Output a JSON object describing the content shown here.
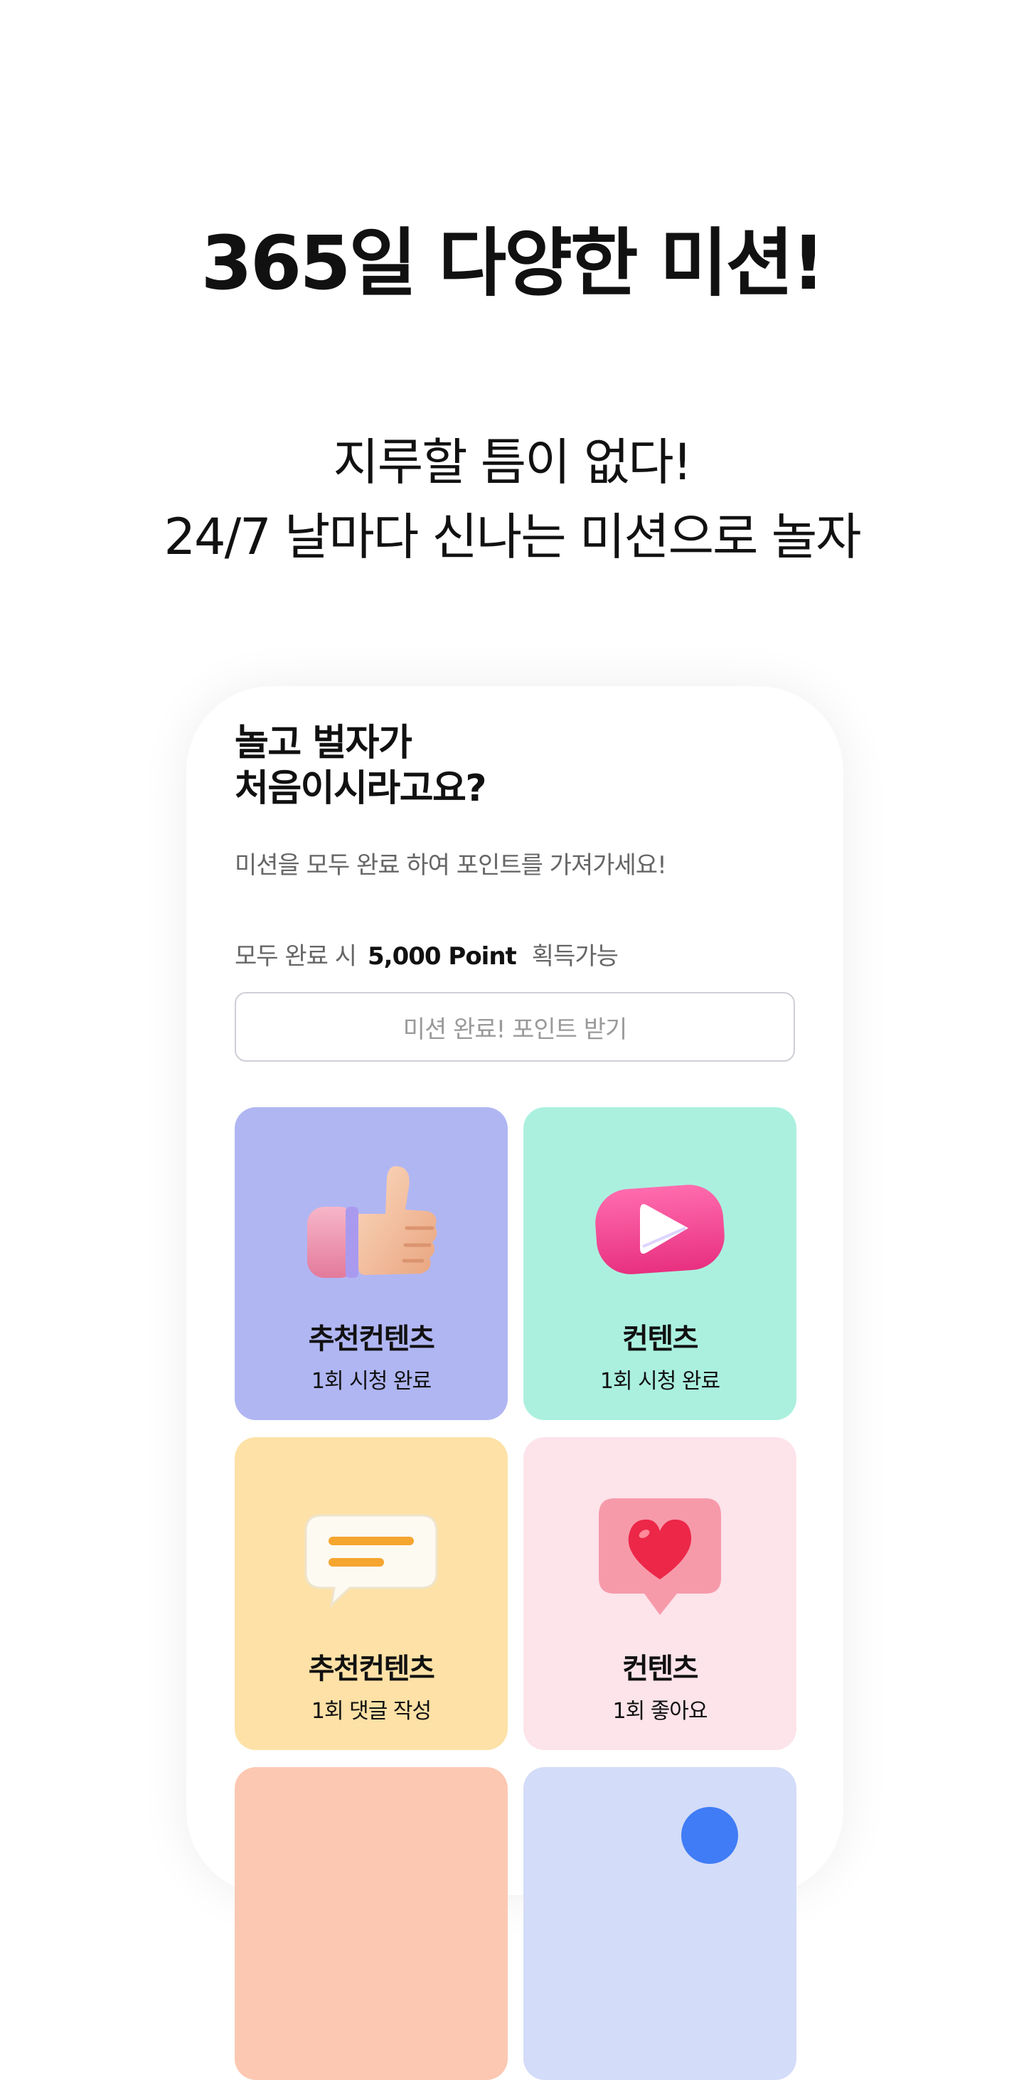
{
  "headline": "365일 다양한 미션!",
  "subline": {
    "line1": "지루할 틈이 없다!",
    "line2": "24/7 날마다 신나는 미션으로 놀자"
  },
  "card": {
    "title_line1": "놀고 벌자가",
    "title_line2": "처음이시라고요?",
    "description": "미션을 모두 완료 하여 포인트를 가져가세요!",
    "reward_prefix": "모두 완료 시",
    "reward_points": "5,000 Point",
    "reward_suffix": "획득가능",
    "claim_button": "미션 완료! 포인트 받기"
  },
  "missions": [
    {
      "title": "추천컨텐츠",
      "subtitle": "1회 시청 완료",
      "icon": "thumbs-up-icon",
      "color": "#b0b6f2"
    },
    {
      "title": "컨텐츠",
      "subtitle": "1회 시청 완료",
      "icon": "play-icon",
      "color": "#abf0df"
    },
    {
      "title": "추천컨텐츠",
      "subtitle": "1회 댓글 작성",
      "icon": "speech-bubble-icon",
      "color": "#fde1a6"
    },
    {
      "title": "컨텐츠",
      "subtitle": "1회 좋아요",
      "icon": "heart-bubble-icon",
      "color": "#fde3ea"
    },
    {
      "title": "",
      "subtitle": "",
      "icon": "",
      "color": "#fcc8b2"
    },
    {
      "title": "",
      "subtitle": "",
      "icon": "location-pin-icon",
      "color": "#d3dcf8"
    }
  ]
}
